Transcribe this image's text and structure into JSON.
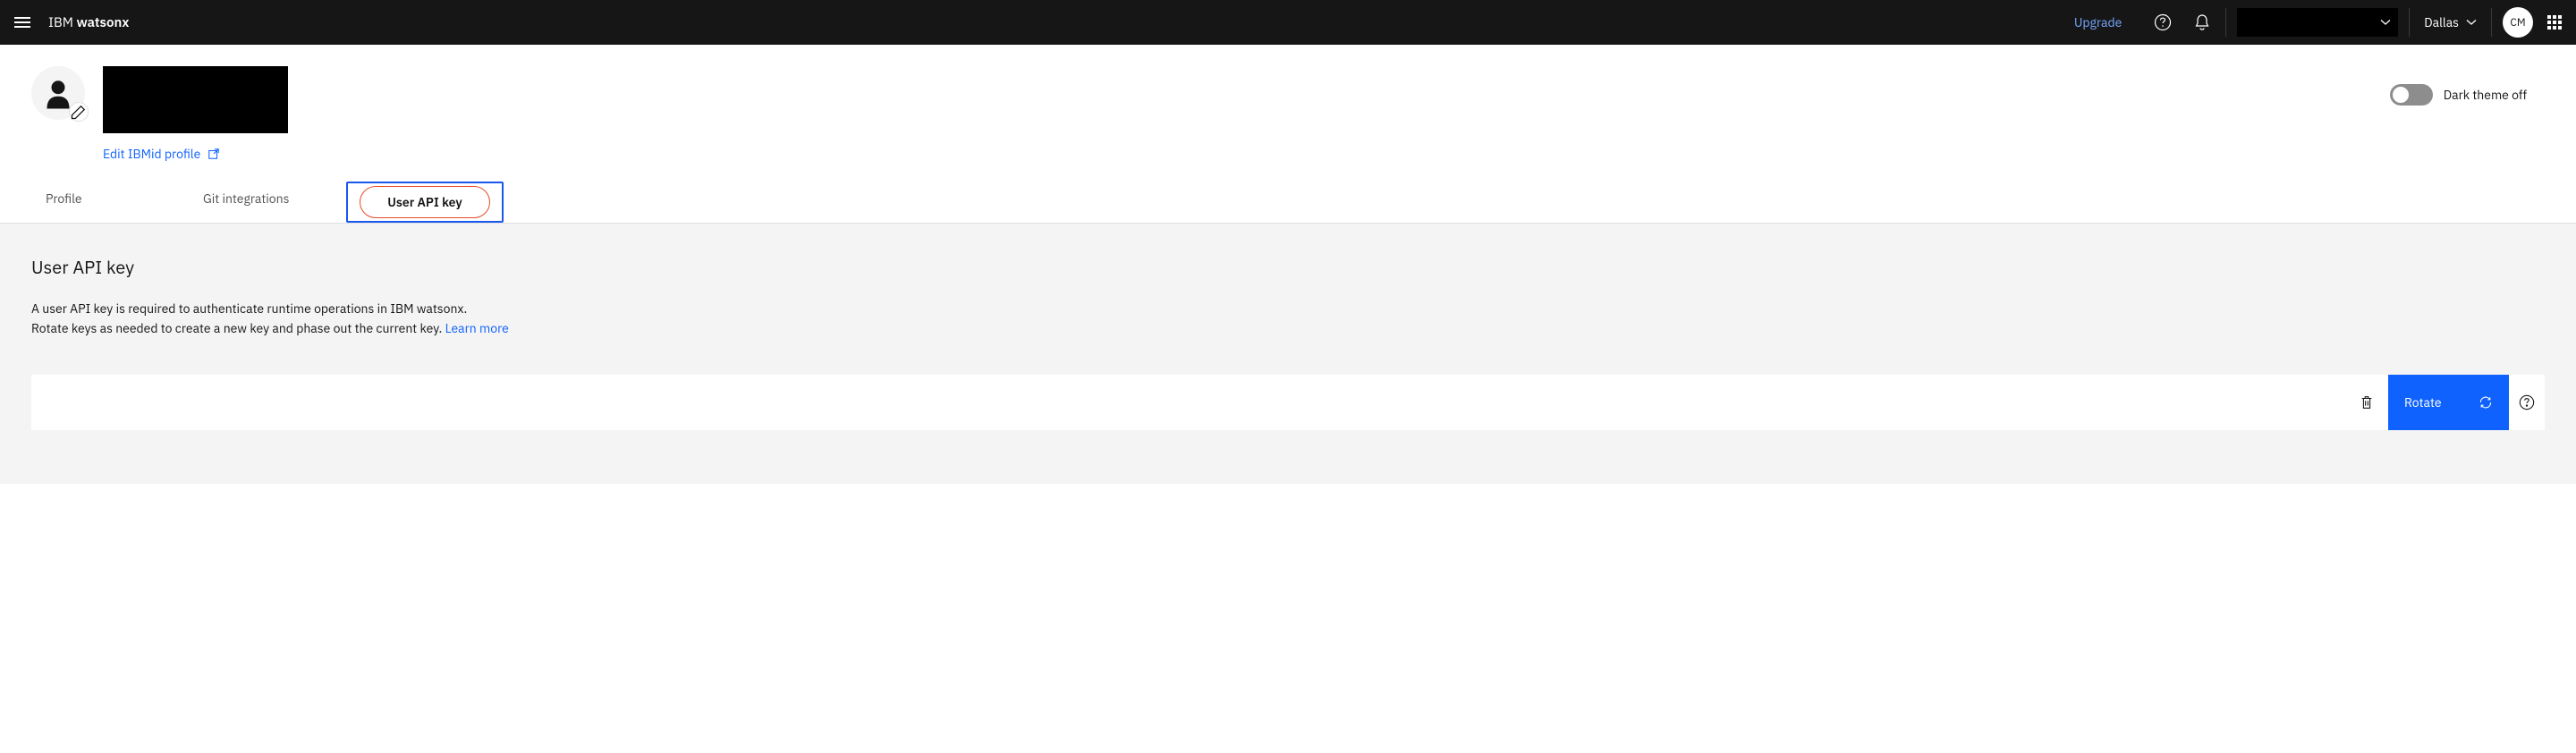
{
  "header": {
    "brand_light": "IBM ",
    "brand_bold": "watsonx",
    "upgrade": "Upgrade",
    "region": "Dallas",
    "avatar_initials": "CM"
  },
  "profile": {
    "edit_link": "Edit IBMid profile"
  },
  "theme": {
    "label": "Dark theme off"
  },
  "tabs": [
    {
      "id": "profile",
      "label": "Profile",
      "active": false
    },
    {
      "id": "git",
      "label": "Git integrations",
      "active": false
    },
    {
      "id": "api-key",
      "label": "User API key",
      "active": true
    }
  ],
  "content": {
    "title": "User API key",
    "desc_line1": "A user API key is required to authenticate runtime operations in IBM watsonx.",
    "desc_line2": "Rotate keys as needed to create a new key and phase out the current key. ",
    "learn_more": "Learn more"
  },
  "key_actions": {
    "rotate": "Rotate"
  }
}
